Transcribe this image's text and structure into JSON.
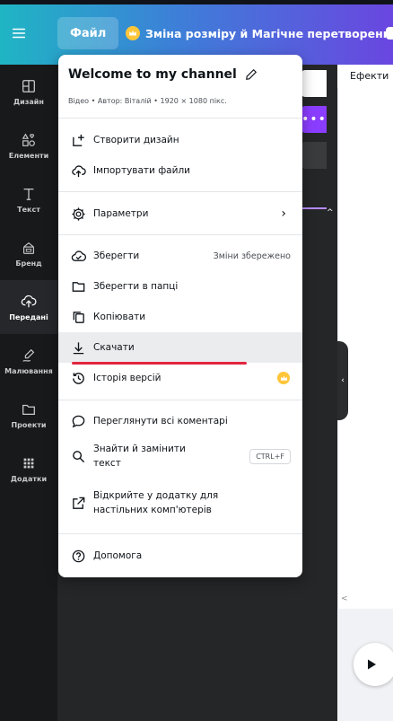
{
  "topbar": {
    "file_label": "Файл",
    "resize_label": "Зміна розміру й Магічне перетворення"
  },
  "sidebar": {
    "items": [
      {
        "label": "Дизайн",
        "icon": "layout-icon"
      },
      {
        "label": "Елементи",
        "icon": "shapes-icon"
      },
      {
        "label": "Текст",
        "icon": "text-icon"
      },
      {
        "label": "Бренд",
        "icon": "brand-icon"
      },
      {
        "label": "Передані",
        "icon": "upload-icon"
      },
      {
        "label": "Малювання",
        "icon": "draw-icon"
      },
      {
        "label": "Проекти",
        "icon": "folder-icon"
      },
      {
        "label": "Додатки",
        "icon": "apps-icon"
      }
    ],
    "active": "Передані"
  },
  "canvas": {
    "effects_label": "Ефекти"
  },
  "menu": {
    "title": "Welcome to my channel",
    "subtitle": "Відео • Автор: Віталій • 1920 × 1080 пікс.",
    "items": {
      "create_design": "Створити дизайн",
      "import_files": "Імпортувати файли",
      "settings": "Параметри",
      "save": "Зберегти",
      "save_status": "Зміни збережено",
      "save_to_folder": "Зберегти в папці",
      "copy": "Копіювати",
      "download": "Скачати",
      "version_history": "Історія версій",
      "view_comments": "Переглянути всі коментарі",
      "find_replace": "Знайти й замінити текст",
      "find_replace_shortcut": "CTRL+F",
      "open_desktop": "Відкрийте у додатку для настільних комп'ютерів",
      "help": "Допомога"
    }
  },
  "colors": {
    "topbar_start": "#1fb5c4",
    "topbar_end": "#6a46e0",
    "sidebar_bg": "#18191b",
    "accent_purple": "#8b3dff",
    "highlight_red": "#e3253f",
    "crown_gold": "#ffc63a"
  }
}
